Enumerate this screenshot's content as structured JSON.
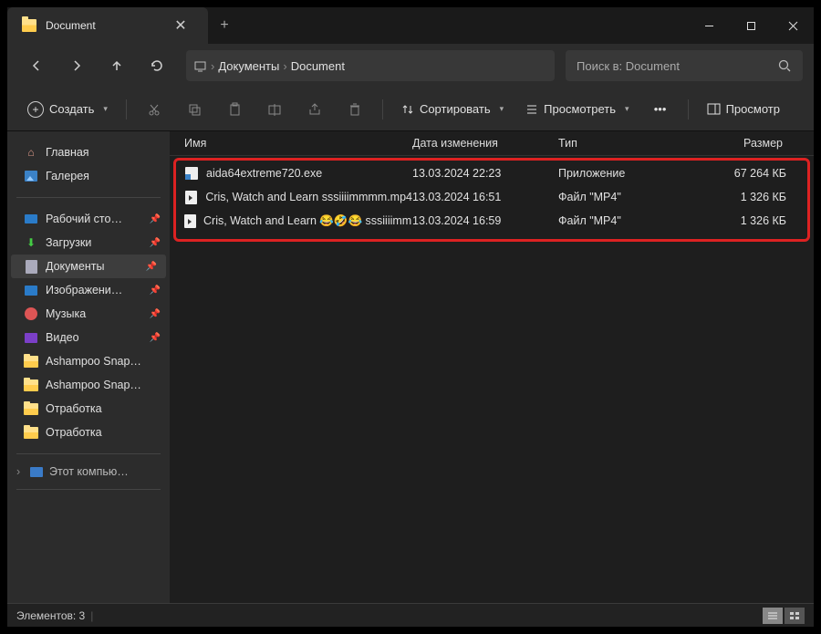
{
  "tab": {
    "title": "Document"
  },
  "breadcrumb": {
    "item1": "Документы",
    "item2": "Document"
  },
  "search": {
    "placeholder": "Поиск в: Document"
  },
  "toolbar": {
    "create": "Создать",
    "sort": "Сортировать",
    "view": "Просмотреть",
    "preview": "Просмотр"
  },
  "sidebar": {
    "home": "Главная",
    "gallery": "Галерея",
    "desktop": "Рабочий сто…",
    "downloads": "Загрузки",
    "documents": "Документы",
    "images": "Изображени…",
    "music": "Музыка",
    "video": "Видео",
    "ashampoo1": "Ashampoo Snap…",
    "ashampoo2": "Ashampoo Snap…",
    "otrabotka1": "Отработка",
    "otrabotka2": "Отработка",
    "thispc": "Этот компью…"
  },
  "columns": {
    "name": "Имя",
    "modified": "Дата изменения",
    "type": "Тип",
    "size": "Размер"
  },
  "files": {
    "f0": {
      "name": "aida64extreme720.exe",
      "modified": "13.03.2024 22:23",
      "type": "Приложение",
      "size": "67 264 КБ"
    },
    "f1": {
      "name": "Cris, Watch and Learn   sssiiiimmmm.mp4",
      "modified": "13.03.2024 16:51",
      "type": "Файл \"MP4\"",
      "size": "1 326 КБ"
    },
    "f2": {
      "name": "Cris, Watch and Learn 😂🤣😂 sssiiiimmm…",
      "modified": "13.03.2024 16:59",
      "type": "Файл \"MP4\"",
      "size": "1 326 КБ"
    }
  },
  "status": {
    "count": "Элементов: 3"
  }
}
